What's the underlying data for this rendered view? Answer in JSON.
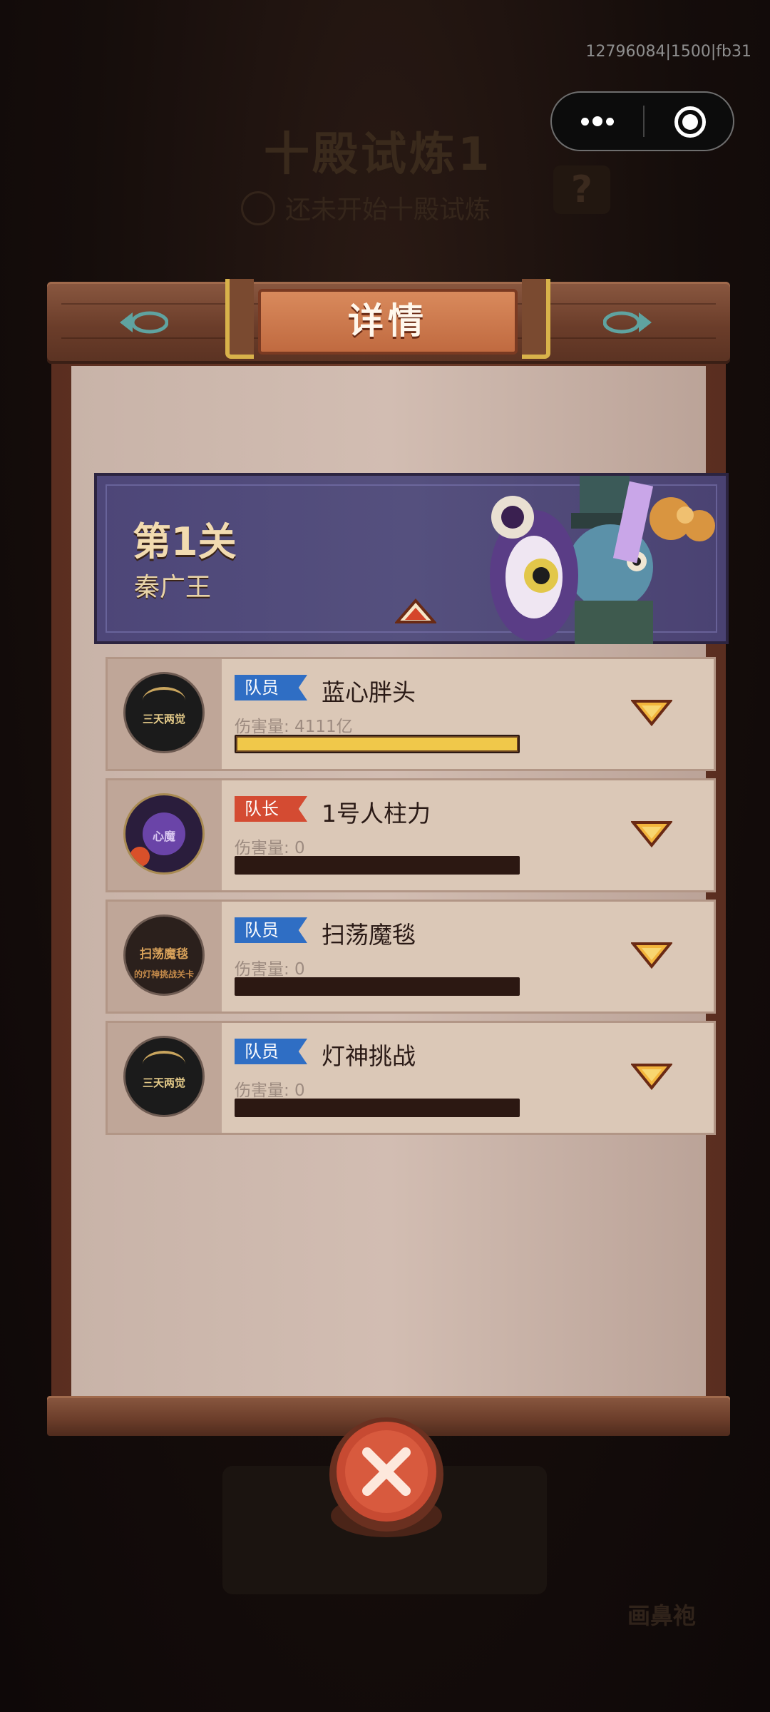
{
  "background": {
    "title": "十殿试炼1",
    "status": "还未开始十殿试炼",
    "help_symbol": "?",
    "right_label": "画鼻袍"
  },
  "build_id": "12796084|1500|fb31",
  "dialog": {
    "title": "详情",
    "stage": {
      "title": "第1关",
      "name": "秦广王"
    },
    "members": [
      {
        "role": "队员",
        "role_type": "member",
        "name": "蓝心胖头",
        "damage": "伤害量: 4111亿",
        "damage_fill": 1.0,
        "avatar": "三天两觉"
      },
      {
        "role": "队长",
        "role_type": "captain",
        "name": "1号人柱力",
        "damage": "伤害量: 0",
        "damage_fill": 0,
        "avatar": "心魔"
      },
      {
        "role": "队员",
        "role_type": "member",
        "name": "扫荡魔毯",
        "damage": "伤害量: 0",
        "damage_fill": 0,
        "avatar": "扫荡魔毯",
        "avatar_sub": "的灯神挑战关卡"
      },
      {
        "role": "队员",
        "role_type": "member",
        "name": "灯神挑战",
        "damage": "伤害量: 0",
        "damage_fill": 0,
        "avatar": "三天两觉"
      }
    ]
  },
  "colors": {
    "member_tag": "#2f6ec4",
    "captain_tag": "#d44b32",
    "bar_fill": "#f0c84a",
    "stage_bg": "#4d4678"
  },
  "icons": {
    "capsule_menu": "more-dots-icon",
    "capsule_close": "target-circle-icon",
    "close": "close-x-icon",
    "expand": "chevron-down-icon",
    "collapse": "chevron-up-icon"
  }
}
